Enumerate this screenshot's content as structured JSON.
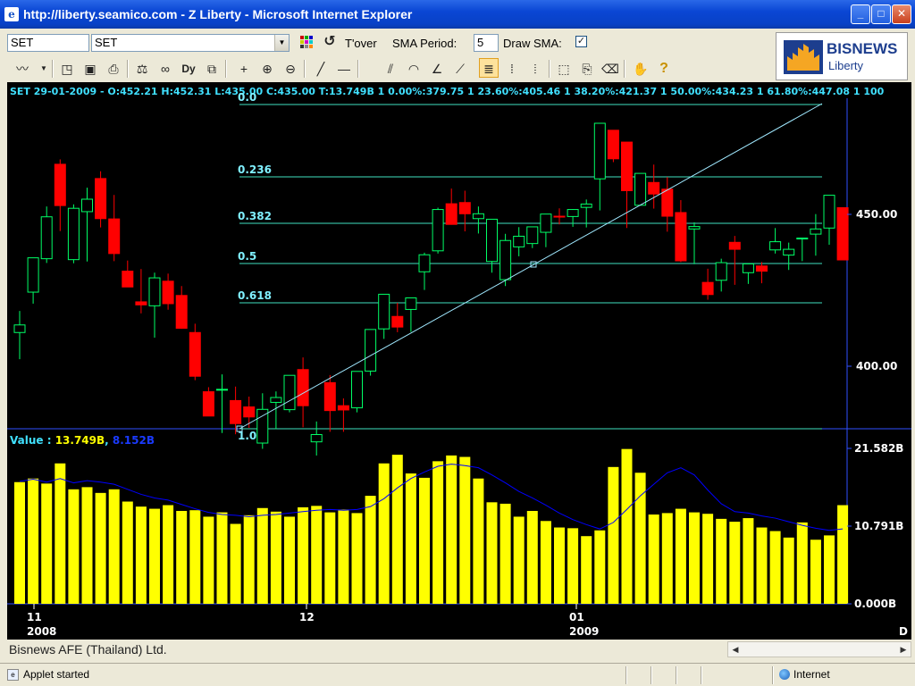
{
  "window": {
    "title": "http://liberty.seamico.com - Z Liberty - Microsoft Internet Explorer",
    "app_icon": "ie-page-icon",
    "minimize": "_",
    "maximize": "□",
    "close": "✕"
  },
  "toolbar": {
    "symbol_value": "SET",
    "symbol_combo_value": "SET",
    "tover_label": "T'over",
    "sma_period_label": "SMA Period:",
    "sma_period_value": "5",
    "draw_sma_label": "Draw SMA:",
    "draw_sma_checked": "✓"
  },
  "logo": {
    "brand": "BISNEWS",
    "sub": "Liberty"
  },
  "chart": {
    "header": "SET 29-01-2009 - O:452.21 H:452.31 L:435.00 C:435.00 T:13.749B 1 0.00%:379.75 1 23.60%:405.46 1 38.20%:421.37 1 50.00%:434.23 1 61.80%:447.08 1 100",
    "price_axis": [
      "450.00",
      "400.00"
    ],
    "fib_levels": [
      "0.0",
      "0.236",
      "0.382",
      "0.5",
      "0.618",
      "1.0"
    ],
    "volume_header_label": "Value : ",
    "volume_value": "13.749B",
    "volume_sma_value": "8.152B",
    "volume_axis": [
      "21.582B",
      "10.791B",
      "0.000B"
    ],
    "x_labels": [
      {
        "day": "11",
        "year": "2008"
      },
      {
        "day": "12",
        "year": ""
      },
      {
        "day": "01",
        "year": "2009"
      }
    ],
    "x_corner": "D",
    "colors": {
      "up": "#00ff66",
      "down": "#ff0000",
      "fib": "#40e0c0",
      "volume": "#ffff00",
      "sma": "#0000ff"
    }
  },
  "chart_data": {
    "type": "candlestick",
    "title": "SET",
    "price_range": [
      372,
      480
    ],
    "volume_range": [
      0,
      21.582
    ],
    "candles": [
      {
        "o": 411.1,
        "h": 418.2,
        "l": 402.3,
        "c": 413.6
      },
      {
        "o": 424.4,
        "h": 435.2,
        "l": 420.6,
        "c": 435.7
      },
      {
        "o": 435.4,
        "h": 452.6,
        "l": 434.0,
        "c": 449.2
      },
      {
        "o": 466.5,
        "h": 468.1,
        "l": 444.5,
        "c": 452.9
      },
      {
        "o": 435.1,
        "h": 453.3,
        "l": 433.9,
        "c": 452.0
      },
      {
        "o": 450.9,
        "h": 458.8,
        "l": 434.5,
        "c": 455.0
      },
      {
        "o": 461.8,
        "h": 464.2,
        "l": 445.7,
        "c": 448.6
      },
      {
        "o": 448.5,
        "h": 456.4,
        "l": 434.6,
        "c": 437.1
      },
      {
        "o": 431.3,
        "h": 434.8,
        "l": 426.4,
        "c": 426.1
      },
      {
        "o": 421.2,
        "h": 432.0,
        "l": 417.4,
        "c": 420.2
      },
      {
        "o": 419.9,
        "h": 430.8,
        "l": 409.4,
        "c": 429.1
      },
      {
        "o": 428.0,
        "h": 430.5,
        "l": 418.6,
        "c": 420.6
      },
      {
        "o": 423.3,
        "h": 426.4,
        "l": 412.3,
        "c": 412.5
      },
      {
        "o": 411.1,
        "h": 414.0,
        "l": 395.4,
        "c": 396.7
      },
      {
        "o": 391.6,
        "h": 393.1,
        "l": 383.6,
        "c": 383.6
      },
      {
        "o": 392.2,
        "h": 397.3,
        "l": 378.0,
        "c": 392.4
      },
      {
        "o": 388.7,
        "h": 393.3,
        "l": 377.6,
        "c": 381.1
      },
      {
        "o": 386.6,
        "h": 390.0,
        "l": 379.7,
        "c": 383.3
      },
      {
        "o": 374.7,
        "h": 391.1,
        "l": 372.8,
        "c": 385.8
      },
      {
        "o": 388.1,
        "h": 391.7,
        "l": 379.3,
        "c": 389.7
      },
      {
        "o": 385.7,
        "h": 392.6,
        "l": 384.8,
        "c": 397.0
      },
      {
        "o": 398.9,
        "h": 402.9,
        "l": 379.9,
        "c": 387.0
      },
      {
        "o": 375.1,
        "h": 381.8,
        "l": 370.6,
        "c": 377.5
      },
      {
        "o": 394.6,
        "h": 397.1,
        "l": 378.4,
        "c": 385.4
      },
      {
        "o": 387.0,
        "h": 389.4,
        "l": 378.4,
        "c": 385.6
      },
      {
        "o": 386.3,
        "h": 397.1,
        "l": 384.8,
        "c": 398.3
      },
      {
        "o": 398.4,
        "h": 410.1,
        "l": 396.9,
        "c": 412.1
      },
      {
        "o": 412.3,
        "h": 419.9,
        "l": 409.0,
        "c": 423.7
      },
      {
        "o": 416.4,
        "h": 420.9,
        "l": 411.2,
        "c": 412.9
      },
      {
        "o": 418.7,
        "h": 421.7,
        "l": 411.3,
        "c": 422.5
      },
      {
        "o": 431.1,
        "h": 437.4,
        "l": 425.1,
        "c": 436.7
      },
      {
        "o": 438.0,
        "h": 452.2,
        "l": 437.1,
        "c": 451.6
      },
      {
        "o": 453.5,
        "h": 458.5,
        "l": 446.6,
        "c": 446.7
      },
      {
        "o": 453.9,
        "h": 457.8,
        "l": 444.4,
        "c": 450.2
      },
      {
        "o": 448.6,
        "h": 452.6,
        "l": 443.7,
        "c": 450.2
      },
      {
        "o": 434.5,
        "h": 448.0,
        "l": 430.8,
        "c": 448.4
      },
      {
        "o": 428.5,
        "h": 443.6,
        "l": 426.4,
        "c": 441.4
      },
      {
        "o": 439.3,
        "h": 445.8,
        "l": 436.2,
        "c": 442.8
      },
      {
        "o": 440.4,
        "h": 444.2,
        "l": 438.9,
        "c": 445.9
      },
      {
        "o": 444.1,
        "h": 447.2,
        "l": 439.2,
        "c": 450.1
      },
      {
        "o": 449.4,
        "h": 452.0,
        "l": 446.7,
        "c": 449.2
      },
      {
        "o": 449.3,
        "h": 451.7,
        "l": 445.9,
        "c": 451.6
      },
      {
        "o": 452.3,
        "h": 454.9,
        "l": 445.7,
        "c": 453.4
      },
      {
        "o": 461.7,
        "h": 475.3,
        "l": 451.3,
        "c": 480.0
      },
      {
        "o": 477.7,
        "h": 473.7,
        "l": 467.2,
        "c": 468.3
      },
      {
        "o": 473.8,
        "h": 470.5,
        "l": 445.5,
        "c": 457.8
      },
      {
        "o": 453.0,
        "h": 463.1,
        "l": 453.5,
        "c": 463.5
      },
      {
        "o": 460.5,
        "h": 466.4,
        "l": 451.9,
        "c": 456.7
      },
      {
        "o": 458.3,
        "h": 462.3,
        "l": 444.3,
        "c": 449.4
      },
      {
        "o": 450.6,
        "h": 454.7,
        "l": 434.3,
        "c": 434.7
      },
      {
        "o": 445.2,
        "h": 447.4,
        "l": 433.6,
        "c": 446.0
      },
      {
        "o": 427.6,
        "h": 432.1,
        "l": 421.9,
        "c": 423.6
      },
      {
        "o": 428.3,
        "h": 435.4,
        "l": 424.6,
        "c": 434.1
      },
      {
        "o": 440.8,
        "h": 442.9,
        "l": 426.8,
        "c": 438.5
      },
      {
        "o": 430.8,
        "h": 433.7,
        "l": 427.1,
        "c": 433.7
      },
      {
        "o": 433.0,
        "h": 434.3,
        "l": 427.3,
        "c": 431.3
      },
      {
        "o": 438.3,
        "h": 445.5,
        "l": 437.1,
        "c": 441.0
      },
      {
        "o": 436.6,
        "h": 440.7,
        "l": 431.7,
        "c": 438.5
      },
      {
        "o": 442.2,
        "h": 439.4,
        "l": 434.6,
        "c": 442.2
      },
      {
        "o": 443.5,
        "h": 450.1,
        "l": 436.4,
        "c": 445.2
      },
      {
        "o": 445.5,
        "h": 455.7,
        "l": 440.0,
        "c": 456.3
      },
      {
        "o": 452.2,
        "h": 452.3,
        "l": 435.0,
        "c": 435.0
      }
    ],
    "volume": [
      16.9,
      17.4,
      16.7,
      19.5,
      15.9,
      16.2,
      15.4,
      15.9,
      14.2,
      13.5,
      13.2,
      13.7,
      12.9,
      13.0,
      12.1,
      12.7,
      11.1,
      12.3,
      13.3,
      12.8,
      12.1,
      13.4,
      13.6,
      12.7,
      13.1,
      12.6,
      15.0,
      19.5,
      20.7,
      18.1,
      17.5,
      19.8,
      20.6,
      20.4,
      17.4,
      14.1,
      13.9,
      12.1,
      12.9,
      11.5,
      10.6,
      10.5,
      9.4,
      10.2,
      19.0,
      21.5,
      18.2,
      12.4,
      12.6,
      13.2,
      12.7,
      12.5,
      11.8,
      11.4,
      11.9,
      10.6,
      10.1,
      9.2,
      11.3,
      8.9,
      9.5,
      13.7
    ],
    "volume_sma": [
      17.0,
      17.3,
      16.9,
      17.4,
      16.8,
      17.1,
      16.9,
      16.6,
      15.9,
      15.2,
      14.7,
      14.4,
      13.8,
      13.2,
      12.7,
      12.4,
      12.3,
      12.1,
      12.3,
      12.4,
      12.6,
      12.8,
      13.0,
      13.1,
      13.0,
      13.1,
      13.5,
      14.6,
      16.1,
      17.4,
      18.3,
      19.1,
      19.4,
      19.2,
      18.9,
      17.9,
      16.8,
      15.6,
      14.7,
      13.7,
      12.6,
      11.7,
      11.0,
      10.4,
      11.3,
      13.1,
      15.0,
      16.6,
      18.2,
      18.9,
      17.9,
      15.8,
      13.9,
      12.8,
      12.6,
      12.2,
      11.9,
      11.4,
      10.9,
      10.5,
      10.2,
      10.4
    ],
    "fib_levels": [
      0.0,
      0.236,
      0.382,
      0.5,
      0.618,
      1.0
    ],
    "fib_prices": [
      379.75,
      405.46,
      421.37,
      434.23,
      447.08,
      488.7
    ]
  }
}
